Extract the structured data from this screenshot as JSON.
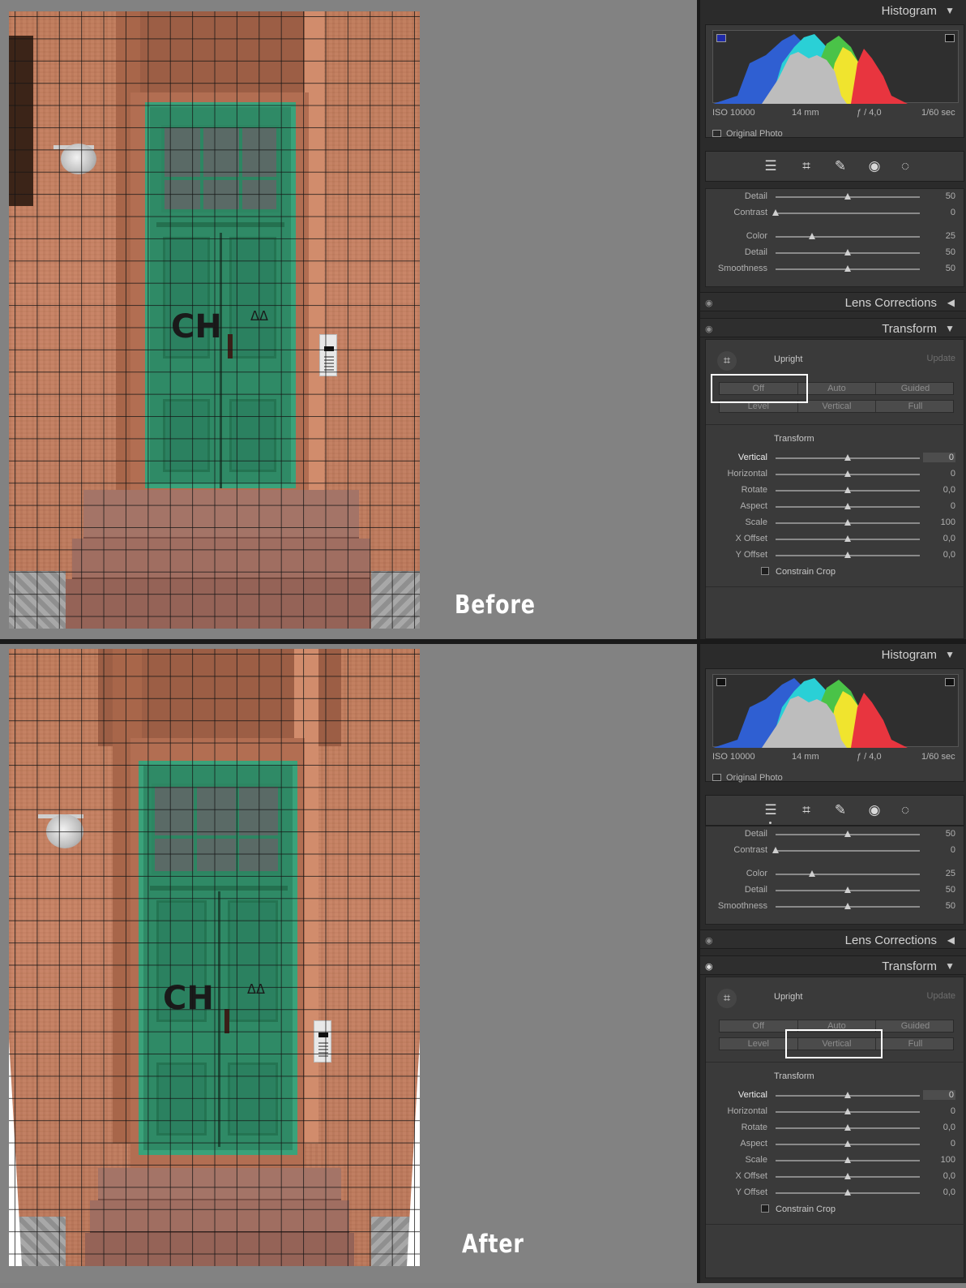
{
  "before": {
    "caption": "Before",
    "histogram": {
      "title": "Histogram",
      "iso": "ISO 10000",
      "focal": "14 mm",
      "aperture": "ƒ / 4,0",
      "shutter": "1/60 sec",
      "original_photo": "Original Photo"
    },
    "detail_sliders": [
      {
        "label": "Detail",
        "value": "50",
        "pos": 0.5
      },
      {
        "label": "Contrast",
        "value": "0",
        "pos": 0.0
      },
      {
        "label": "Color",
        "value": "25",
        "pos": 0.25
      },
      {
        "label": "Detail",
        "value": "50",
        "pos": 0.5
      },
      {
        "label": "Smoothness",
        "value": "50",
        "pos": 0.5
      }
    ],
    "lens_corrections": "Lens Corrections",
    "transform": {
      "title": "Transform",
      "upright": "Upright",
      "update": "Update",
      "buttons_row1": [
        "Off",
        "Auto",
        "Guided"
      ],
      "buttons_row2": [
        "Level",
        "Vertical",
        "Full"
      ],
      "selected": "Off",
      "sub_title": "Transform",
      "sliders": [
        {
          "label": "Vertical",
          "value": "0",
          "pos": 0.5
        },
        {
          "label": "Horizontal",
          "value": "0",
          "pos": 0.5
        },
        {
          "label": "Rotate",
          "value": "0,0",
          "pos": 0.5
        },
        {
          "label": "Aspect",
          "value": "0",
          "pos": 0.5
        },
        {
          "label": "Scale",
          "value": "100",
          "pos": 0.5
        },
        {
          "label": "X Offset",
          "value": "0,0",
          "pos": 0.5
        },
        {
          "label": "Y Offset",
          "value": "0,0",
          "pos": 0.5
        }
      ],
      "constrain_crop": "Constrain Crop"
    }
  },
  "after": {
    "caption": "After",
    "histogram": {
      "title": "Histogram",
      "iso": "ISO 10000",
      "focal": "14 mm",
      "aperture": "ƒ / 4,0",
      "shutter": "1/60 sec",
      "original_photo": "Original Photo"
    },
    "detail_sliders": [
      {
        "label": "Detail",
        "value": "50",
        "pos": 0.5
      },
      {
        "label": "Contrast",
        "value": "0",
        "pos": 0.0
      },
      {
        "label": "Color",
        "value": "25",
        "pos": 0.25
      },
      {
        "label": "Detail",
        "value": "50",
        "pos": 0.5
      },
      {
        "label": "Smoothness",
        "value": "50",
        "pos": 0.5
      }
    ],
    "lens_corrections": "Lens Corrections",
    "transform": {
      "title": "Transform",
      "upright": "Upright",
      "update": "Update",
      "buttons_row1": [
        "Off",
        "Auto",
        "Guided"
      ],
      "buttons_row2": [
        "Level",
        "Vertical",
        "Full"
      ],
      "selected": "Vertical",
      "sub_title": "Transform",
      "sliders": [
        {
          "label": "Vertical",
          "value": "0",
          "pos": 0.5
        },
        {
          "label": "Horizontal",
          "value": "0",
          "pos": 0.5
        },
        {
          "label": "Rotate",
          "value": "0,0",
          "pos": 0.5
        },
        {
          "label": "Aspect",
          "value": "0",
          "pos": 0.5
        },
        {
          "label": "Scale",
          "value": "100",
          "pos": 0.5
        },
        {
          "label": "X Offset",
          "value": "0,0",
          "pos": 0.5
        },
        {
          "label": "Y Offset",
          "value": "0,0",
          "pos": 0.5
        }
      ],
      "constrain_crop": "Constrain Crop"
    }
  },
  "icons": {
    "tools": [
      "sliders-icon",
      "crop-icon",
      "healing-icon",
      "redeye-icon",
      "mask-icon"
    ],
    "tool_glyphs": [
      "☰",
      "⌗",
      "✎",
      "◉",
      "◌"
    ]
  },
  "colors": {
    "panel_bg": "#2b2b2b",
    "section_bg": "#3a3a3a",
    "highlight": "#ffffff"
  }
}
